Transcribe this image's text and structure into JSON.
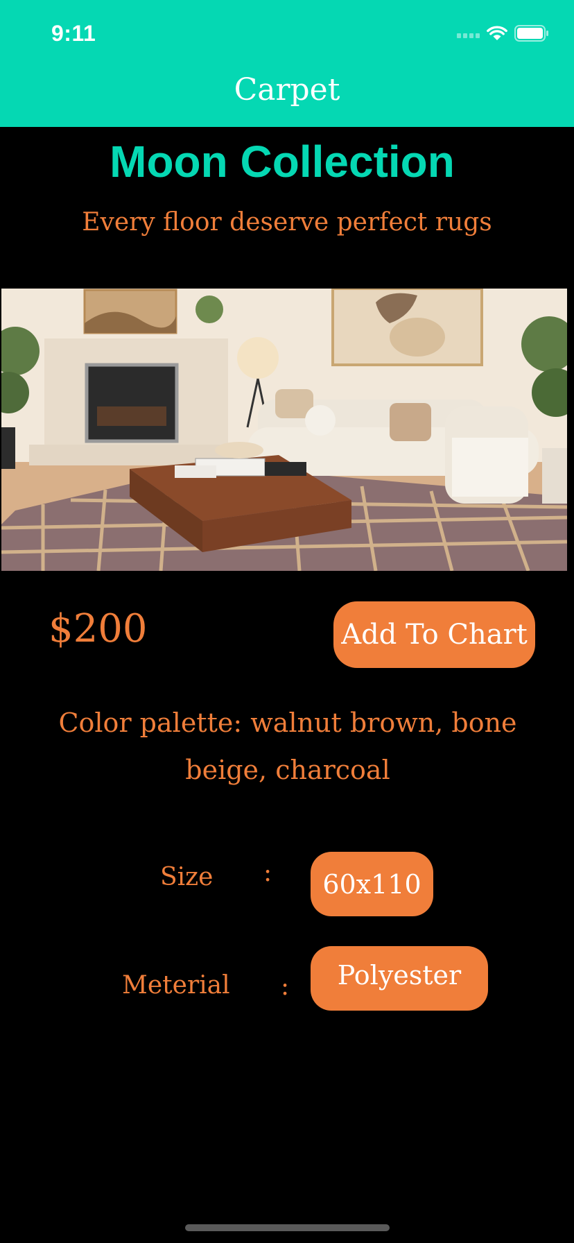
{
  "status_bar": {
    "time": "9:11"
  },
  "nav": {
    "title": "Carpet"
  },
  "product": {
    "title": "Moon Collection",
    "subtitle": "Every floor deserve perfect rugs",
    "price": "$200",
    "add_button_label": "Add To Chart",
    "palette_text": "Color palette: walnut brown, bone beige, charcoal",
    "attributes": {
      "size_label": "Size",
      "size_value": "60x110",
      "material_label": "Meterial",
      "material_value": "Polyester",
      "separator": ":"
    }
  },
  "colors": {
    "header": "#05D8B3",
    "accent": "#F07E3A",
    "background": "#000000"
  },
  "icons": [
    "cellular-signal-icon",
    "wifi-icon",
    "battery-icon"
  ]
}
